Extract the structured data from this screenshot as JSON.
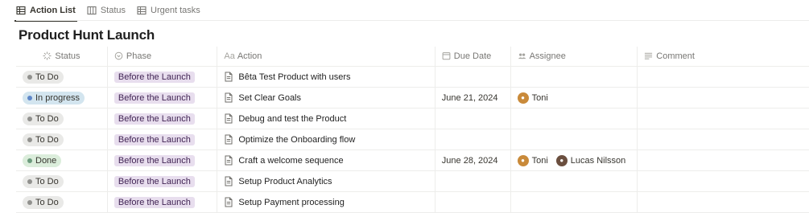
{
  "tabs": [
    {
      "label": "Action List",
      "icon": "table-icon",
      "active": true
    },
    {
      "label": "Status",
      "icon": "board-icon",
      "active": false
    },
    {
      "label": "Urgent tasks",
      "icon": "table-icon",
      "active": false
    }
  ],
  "title": "Product Hunt Launch",
  "columns": {
    "status": "Status",
    "phase": "Phase",
    "action": "Action",
    "due": "Due Date",
    "assignee": "Assignee",
    "comment": "Comment"
  },
  "column_icon_text": {
    "action": "Aa"
  },
  "rows": [
    {
      "status": "To Do",
      "status_kind": "todo",
      "phase": "Before the Launch",
      "action": "Bêta Test Product with users",
      "due": "",
      "assignees": [],
      "comment": ""
    },
    {
      "status": "In progress",
      "status_kind": "progress",
      "phase": "Before the Launch",
      "action": "Set Clear Goals",
      "due": "June 21, 2024",
      "assignees": [
        "Toni"
      ],
      "comment": ""
    },
    {
      "status": "To Do",
      "status_kind": "todo",
      "phase": "Before the Launch",
      "action": "Debug and test the Product",
      "due": "",
      "assignees": [],
      "comment": ""
    },
    {
      "status": "To Do",
      "status_kind": "todo",
      "phase": "Before the Launch",
      "action": "Optimize the Onboarding flow",
      "due": "",
      "assignees": [],
      "comment": ""
    },
    {
      "status": "Done",
      "status_kind": "done",
      "phase": "Before the Launch",
      "action": "Craft a welcome sequence",
      "due": "June 28, 2024",
      "assignees": [
        "Toni",
        "Lucas Nilsson"
      ],
      "comment": ""
    },
    {
      "status": "To Do",
      "status_kind": "todo",
      "phase": "Before the Launch",
      "action": "Setup Product Analytics",
      "due": "",
      "assignees": [],
      "comment": ""
    },
    {
      "status": "To Do",
      "status_kind": "todo",
      "phase": "Before the Launch",
      "action": "Setup Payment processing",
      "due": "",
      "assignees": [],
      "comment": ""
    }
  ],
  "colors": {
    "todo": "#e9e9e7",
    "in_progress": "#d3e5ef",
    "done": "#dbeddb",
    "phase": "#e8deee"
  }
}
